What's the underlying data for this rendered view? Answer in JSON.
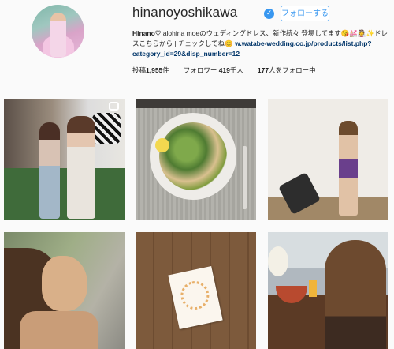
{
  "profile": {
    "username": "hinanoyoshikawa",
    "verified_icon": "verified-check-icon",
    "follow_label": "フォローする",
    "bio": {
      "name": "Hinano♡",
      "text": " alohina moeのウェディングドレス、新作続々 登場してます😘💒👰✨ドレスこちらから | チェックしてね😊 ",
      "link": "w.watabe-wedding.co.jp/products/list.php?category_id=29&disp_number=12"
    },
    "stats": {
      "posts_label": "投稿",
      "posts_value": "1,955",
      "posts_unit": "件",
      "followers_label": "フォロワー",
      "followers_value": "419",
      "followers_unit": "千人",
      "following_value": "177",
      "following_label": "人をフォロー中"
    }
  },
  "colors": {
    "accent": "#3897f0",
    "link": "#003569",
    "text": "#262626",
    "background": "#fafafa"
  },
  "photos": [
    {
      "id": "photo-1",
      "icon": "camera-icon"
    },
    {
      "id": "photo-2"
    },
    {
      "id": "photo-3"
    },
    {
      "id": "photo-4"
    },
    {
      "id": "photo-5"
    },
    {
      "id": "photo-6"
    }
  ]
}
